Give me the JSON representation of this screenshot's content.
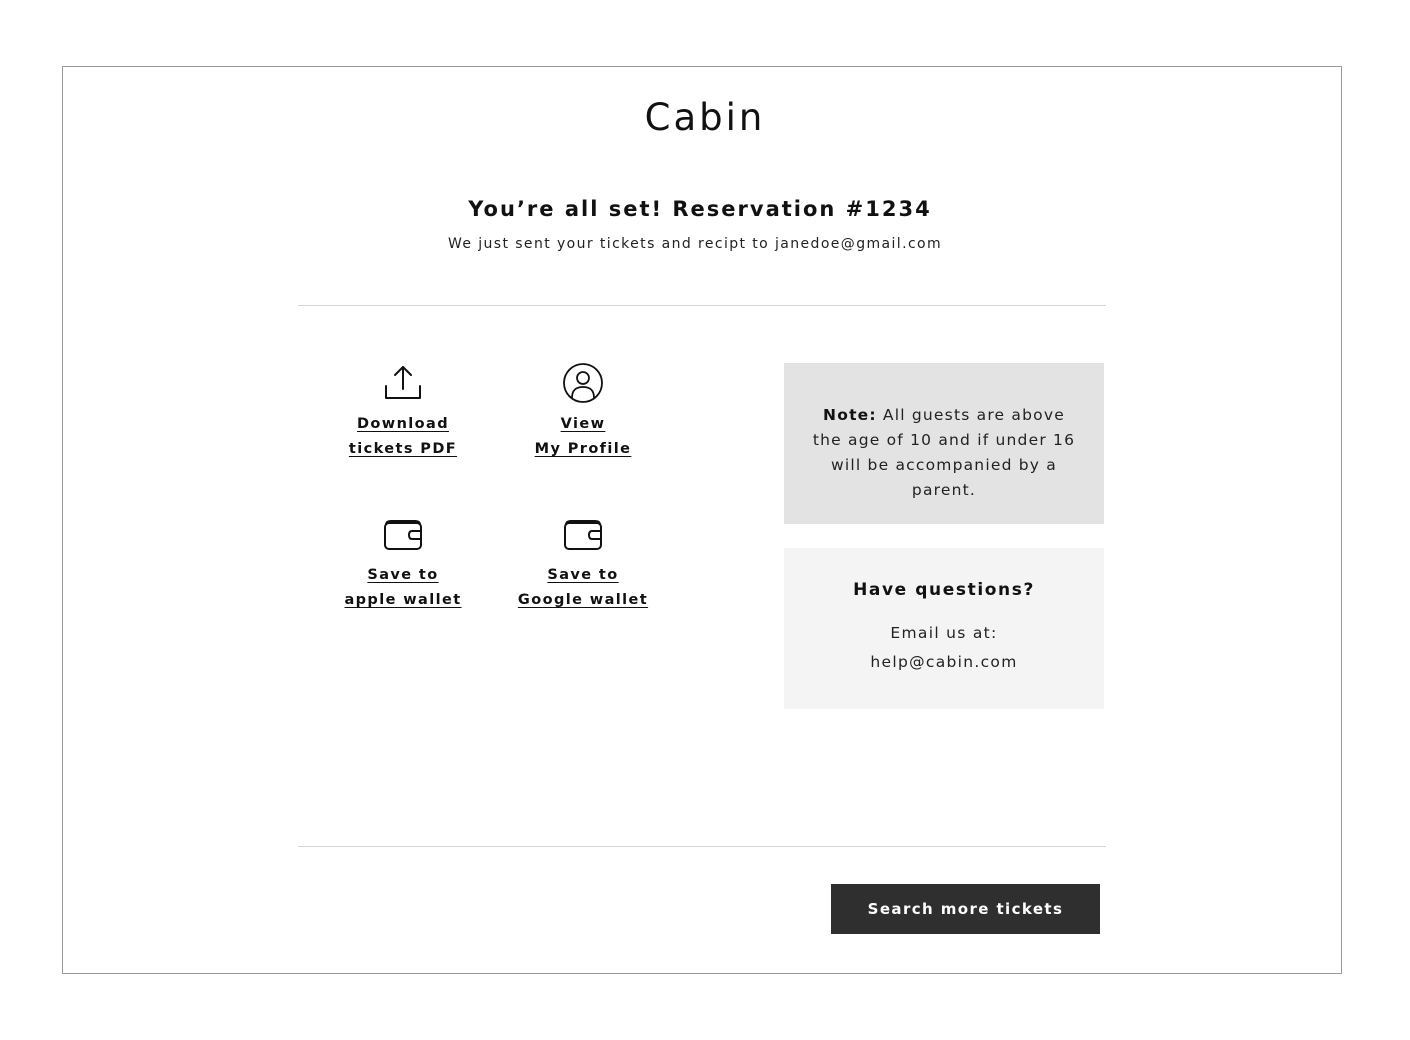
{
  "brand": {
    "logo_text": "Cabin"
  },
  "confirmation": {
    "headline": "You’re all set! Reservation #1234",
    "subline": "We just sent your tickets and recipt to janedoe@gmail.com"
  },
  "actions": [
    {
      "icon": "upload-icon",
      "line1": "Download",
      "line2": "tickets PDF"
    },
    {
      "icon": "user-circle-icon",
      "line1": "View",
      "line2": "My Profile"
    },
    {
      "icon": "wallet-icon",
      "line1": "Save to",
      "line2": "apple wallet"
    },
    {
      "icon": "wallet-icon",
      "line1": "Save to",
      "line2": "Google wallet"
    }
  ],
  "note": {
    "label": "Note:",
    "text": " All guests are above the age of 10 and if under 16 will be accompanied by a parent."
  },
  "questions": {
    "title": "Have questions?",
    "line1": "Email us at:",
    "email": "help@cabin.com"
  },
  "cta": {
    "label": "Search more tickets"
  },
  "colors": {
    "note_bg": "#e3e3e3",
    "questions_bg": "#f4f4f4",
    "button_bg": "#2f2f2f",
    "frame_border": "#9a9a9a"
  }
}
